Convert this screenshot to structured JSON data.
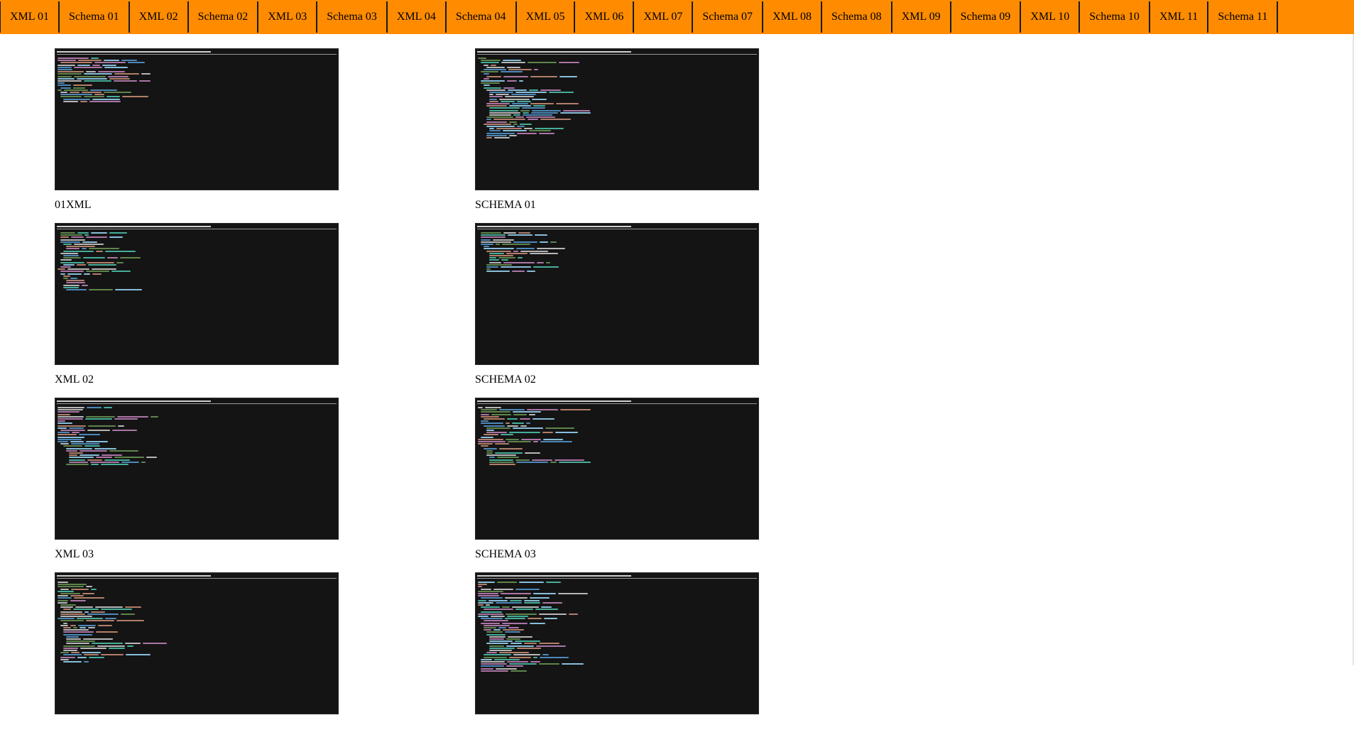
{
  "nav": {
    "items": [
      {
        "label": "XML 01"
      },
      {
        "label": "Schema 01"
      },
      {
        "label": "XML 02"
      },
      {
        "label": "Schema 02"
      },
      {
        "label": "XML 03"
      },
      {
        "label": "Schema 03"
      },
      {
        "label": "XML 04"
      },
      {
        "label": "Schema 04"
      },
      {
        "label": "XML 05"
      },
      {
        "label": "XML 06"
      },
      {
        "label": "XML 07"
      },
      {
        "label": "Schema 07"
      },
      {
        "label": "XML 08"
      },
      {
        "label": "Schema 08"
      },
      {
        "label": "XML 09"
      },
      {
        "label": "Schema 09"
      },
      {
        "label": "XML 10"
      },
      {
        "label": "Schema 10"
      },
      {
        "label": "XML 11"
      },
      {
        "label": "Schema 11"
      }
    ]
  },
  "gallery": {
    "rows": [
      {
        "left": {
          "caption": "01XML"
        },
        "right": {
          "caption": "SCHEMA 01"
        }
      },
      {
        "left": {
          "caption": "XML 02"
        },
        "right": {
          "caption": "SCHEMA 02"
        }
      },
      {
        "left": {
          "caption": "XML 03"
        },
        "right": {
          "caption": "SCHEMA 03"
        }
      },
      {
        "left": {
          "caption": ""
        },
        "right": {
          "caption": ""
        }
      }
    ]
  },
  "colors": {
    "nav_bg": "#ff8c00",
    "thumb_bg": "#141414"
  }
}
